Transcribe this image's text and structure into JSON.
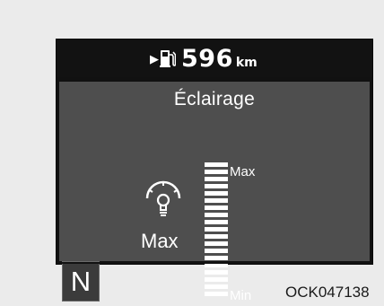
{
  "top_bar": {
    "range_arrow_icon": "arrow-right-icon",
    "fuel_icon": "fuel-pump-icon",
    "range_value": "596",
    "range_unit": "km"
  },
  "panel": {
    "title": "Éclairage",
    "icon": "dashboard-illumination-icon",
    "level_text": "Max",
    "level_fraction": 1.0,
    "scale_max_label": "Max",
    "scale_min_label": "Min"
  },
  "gear": {
    "value": "N"
  },
  "figure_code": "OCK047138",
  "colors": {
    "display_bg": "#111111",
    "panel_bg": "#4e4e4e",
    "text": "#ffffff",
    "page_bg": "#ebebeb"
  }
}
